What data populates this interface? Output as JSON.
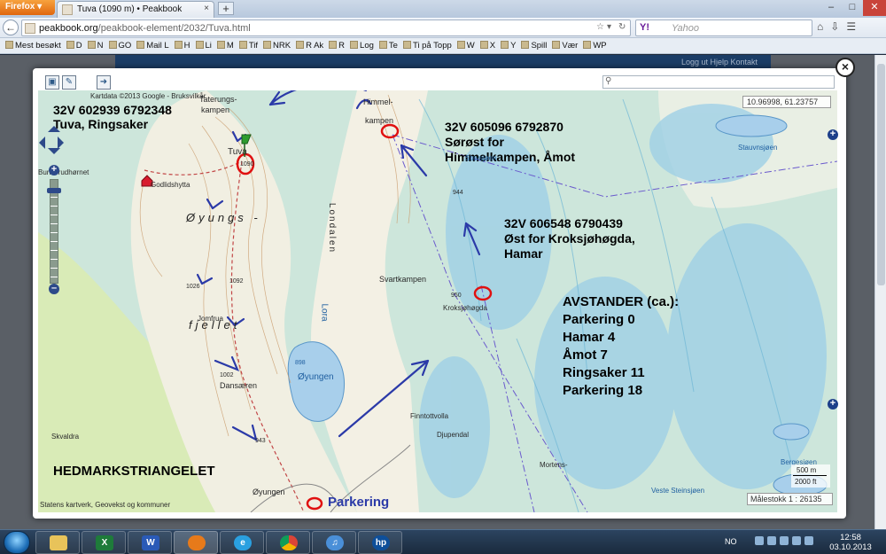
{
  "browser": {
    "menu_button": "Firefox",
    "tab_title": "Tuva (1090 m) • Peakbook",
    "tab_close": "×",
    "new_tab": "+",
    "url_domain": "peakbook.org",
    "url_path": "/peakbook-element/2032/Tuva.html",
    "search_engine": "Y!",
    "search_placeholder": "Yahoo",
    "win_min": "–",
    "win_max": "□",
    "win_close": "✕"
  },
  "bookmarks": [
    "Mest besøkt",
    "D",
    "N",
    "GO",
    "Mail L",
    "H",
    "Li",
    "M",
    "Tif",
    "NRK",
    "R Ak",
    "R",
    "Log",
    "Te",
    "Ti på Topp",
    "W",
    "X",
    "Y",
    "Spill",
    "Vær",
    "WP"
  ],
  "page": {
    "links": "Logg ut   Hjelp   Kontakt"
  },
  "modal": {
    "close_label": "×"
  },
  "map": {
    "coords": "10.96998, 61.23757",
    "copyright": "Kartdata ©2013 Google - Bruksvilkår",
    "attribution": "Statens kartverk, Geovekst og kommuner",
    "scale_text": "Målestokk 1 : 26135",
    "scale_bar_top": "500 m",
    "scale_bar_bottom": "2000 ft",
    "notes": {
      "tuva_coord": "32V 602939 6792348",
      "tuva_name": "Tuva, Ringsaker",
      "himmel_coord": "32V 605096 6792870",
      "himmel_line1": "Sørøst for",
      "himmel_line2": "Himmelkampen, Åmot",
      "kroks_coord": "32V 606548 6790439",
      "kroks_line1": "Øst for Kroksjøhøgda,",
      "kroks_line2": "Hamar",
      "distance_title": "AVSTANDER (ca.):",
      "distances": [
        "Parkering 0",
        "Hamar 4",
        "Åmot 7",
        "Ringsaker 11",
        "Parkering 18"
      ],
      "region": "HEDMARKSTRIANGELET",
      "parking": "Parkering"
    },
    "places": {
      "taterungs1": "Taterungs-",
      "taterungs2": "kampen",
      "himmel1": "Himmel-",
      "himmel2": "kampen",
      "tuva": "Tuva",
      "tuva_height": "1090",
      "godlidshytta": "Godlidshytta",
      "bunkerudhornet": "Bunkerudhørnet",
      "oyungs": "Øyungs -",
      "fjellet": "fjellet",
      "londalen": "Londalen",
      "svartkampen": "Svartkampen",
      "kroksjohogda": "Kroksjøhøgda",
      "oyungen_lake": "Øyungen",
      "dansaren": "Dansæren",
      "jomfrua": "Jomfrua",
      "skvaldra": "Skvaldra",
      "oyungen_farm": "Øyungen",
      "finntottvolla": "Finntottvolla",
      "djupendal": "Djupendal",
      "mortens": "Mortens-",
      "staurvsjoen": "Stauvnsjøen",
      "bergesjoen": "Bergesjøen",
      "vestesteinsjoen": "Veste Steinsjøen",
      "lora": "Lora",
      "stavsjoen": "Stavsjøen",
      "h944": "944",
      "h950": "950",
      "h1092": "1092",
      "h1026": "1026",
      "h1002": "1002",
      "h943": "943",
      "h898": "898"
    }
  },
  "taskbar": {
    "language": "NO",
    "time": "12:58",
    "date": "03.10.2013"
  },
  "colors": {
    "accent_blue": "#2b3aa8",
    "marker_red": "#e01010",
    "lake_blue": "#9ec8e6",
    "forest_green": "#bcdcb4"
  }
}
